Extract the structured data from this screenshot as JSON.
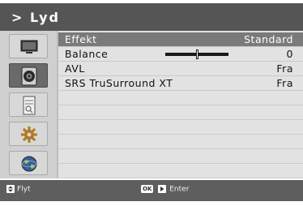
{
  "header": {
    "title": "> Lyd"
  },
  "sidebar": {
    "items": [
      {
        "icon": "tv-icon",
        "active": false
      },
      {
        "icon": "speaker-icon",
        "active": true
      },
      {
        "icon": "document-icon",
        "active": false
      },
      {
        "icon": "gear-icon",
        "active": false
      },
      {
        "icon": "globe-icon",
        "active": false
      }
    ]
  },
  "menu": {
    "rows": [
      {
        "label": "Effekt",
        "value": "Standard"
      },
      {
        "label": "Balance",
        "value": "0",
        "slider_level_percent": 50
      },
      {
        "label": "AVL",
        "value": "Fra"
      },
      {
        "label": "SRS TruSurround XT",
        "value": "Fra"
      }
    ]
  },
  "footer": {
    "move_label": "Flyt",
    "ok_key": "OK",
    "enter_label": "Enter"
  }
}
